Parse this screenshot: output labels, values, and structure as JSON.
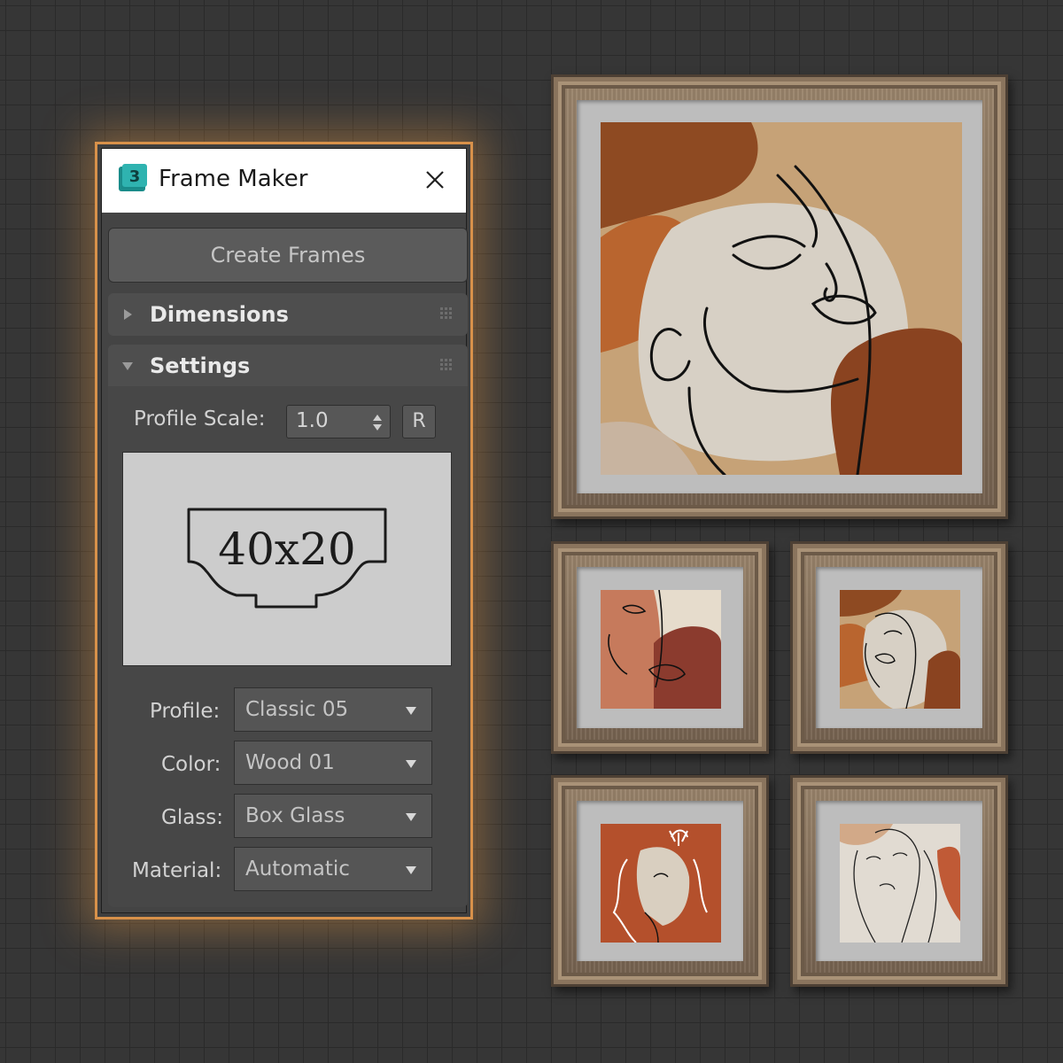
{
  "window": {
    "title": "Frame Maker",
    "app_icon_text": "3"
  },
  "toolbar": {
    "create_label": "Create Frames"
  },
  "sections": {
    "dimensions": {
      "title": "Dimensions",
      "expanded": false
    },
    "settings": {
      "title": "Settings",
      "expanded": true
    }
  },
  "settings": {
    "profile_scale_label": "Profile Scale:",
    "profile_scale_value": "1.0",
    "reset_label": "R",
    "preview_label": "40x20",
    "profile_label": "Profile:",
    "profile_value": "Classic 05",
    "color_label": "Color:",
    "color_value": "Wood 01",
    "glass_label": "Glass:",
    "glass_value": "Box Glass",
    "material_label": "Material:",
    "material_value": "Automatic"
  },
  "colors": {
    "accent": "#d8914a",
    "panel_bg": "#444444",
    "frame_wood": "#8a745d",
    "mat": "#bdbdbd",
    "art_rust": "#b9652f",
    "art_brown": "#8a4320",
    "art_tan": "#c6a277",
    "art_cream": "#d7d0c5"
  },
  "icons": {
    "close": "close-icon",
    "app": "3dsmax-icon",
    "arrow": "triangle-arrow-icon",
    "grip": "grip-dots-icon",
    "spinner": "spinner-arrows-icon",
    "dropdown": "chevron-down-icon"
  }
}
